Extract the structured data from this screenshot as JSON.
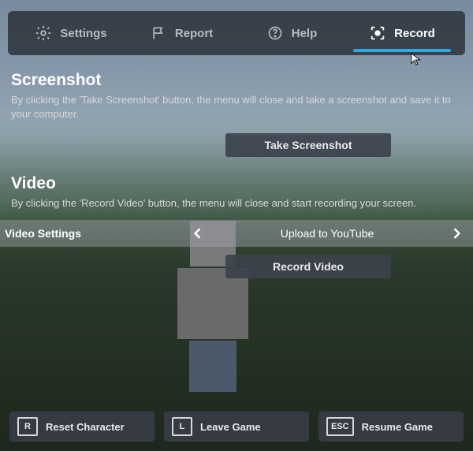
{
  "tabs": {
    "settings": "Settings",
    "report": "Report",
    "help": "Help",
    "record": "Record",
    "active": "record"
  },
  "screenshot": {
    "title": "Screenshot",
    "desc": "By clicking the 'Take Screenshot' button, the menu will close and take a screenshot and save it to your computer.",
    "button": "Take Screenshot"
  },
  "video": {
    "title": "Video",
    "desc": "By clicking the 'Record Video' button, the menu will close and start recording your screen.",
    "setting_label": "Video Settings",
    "setting_value": "Upload to YouTube",
    "button": "Record Video"
  },
  "bottom": {
    "reset": {
      "key": "R",
      "label": "Reset Character"
    },
    "leave": {
      "key": "L",
      "label": "Leave Game"
    },
    "resume": {
      "key": "ESC",
      "label": "Resume Game"
    }
  },
  "colors": {
    "accent": "#2ea8e6"
  }
}
